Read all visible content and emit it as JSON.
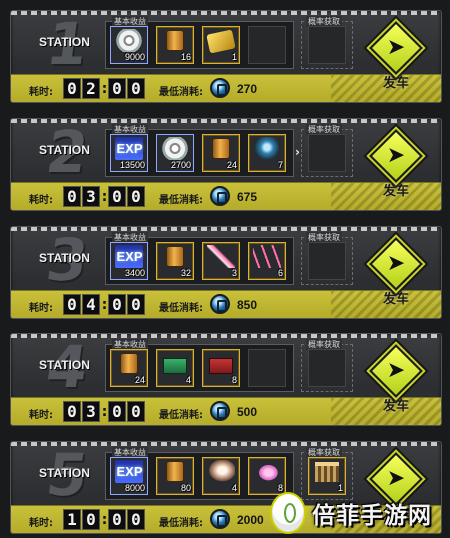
{
  "labels": {
    "station": "STATION",
    "base_reward": "基本收益",
    "prob_reward": "概率获取",
    "time": "耗时:",
    "min_cost": "最低消耗:",
    "depart": "发车"
  },
  "stations": [
    {
      "number": "1",
      "time": [
        "0",
        "2",
        "0",
        "0"
      ],
      "cost": "270",
      "items": [
        {
          "icon": "coin-icon",
          "qty": "9000",
          "style": "blue"
        },
        {
          "icon": "bottle-icon",
          "qty": "16",
          "style": "rare"
        },
        {
          "icon": "card-icon",
          "qty": "1",
          "style": "rare"
        }
      ],
      "prob_items": []
    },
    {
      "number": "2",
      "time": [
        "0",
        "3",
        "0",
        "0"
      ],
      "cost": "675",
      "items": [
        {
          "icon": "exp-icon",
          "qty": "13500",
          "style": "blue"
        },
        {
          "icon": "coin-icon",
          "qty": "2700",
          "style": "blue"
        },
        {
          "icon": "bottle-icon",
          "qty": "24",
          "style": "rare"
        },
        {
          "icon": "armor-icon",
          "qty": "7",
          "style": "rare"
        }
      ],
      "prob_items": []
    },
    {
      "number": "3",
      "time": [
        "0",
        "4",
        "0",
        "0"
      ],
      "cost": "850",
      "items": [
        {
          "icon": "exp-icon",
          "qty": "3400",
          "style": "blue"
        },
        {
          "icon": "bottle-icon",
          "qty": "32",
          "style": "rare"
        },
        {
          "icon": "feather-icon",
          "qty": "3",
          "style": "rare"
        },
        {
          "icon": "crystal-icon",
          "qty": "6",
          "style": "rare"
        }
      ],
      "prob_items": []
    },
    {
      "number": "4",
      "time": [
        "0",
        "3",
        "0",
        "0"
      ],
      "cost": "500",
      "items": [
        {
          "icon": "bottle-icon",
          "qty": "24",
          "style": "rare"
        },
        {
          "icon": "green-kit-icon",
          "qty": "4",
          "style": "rare"
        },
        {
          "icon": "red-kit-icon",
          "qty": "8",
          "style": "rare"
        }
      ],
      "prob_items": []
    },
    {
      "number": "5",
      "time": [
        "1",
        "0",
        "0",
        "0"
      ],
      "cost": "2000",
      "items": [
        {
          "icon": "exp-icon",
          "qty": "8000",
          "style": "blue"
        },
        {
          "icon": "bottle-icon",
          "qty": "80",
          "style": "rare"
        },
        {
          "icon": "wing-icon",
          "qty": "4",
          "style": "rare"
        },
        {
          "icon": "fish-icon",
          "qty": "8",
          "style": "rare"
        }
      ],
      "prob_items": [
        {
          "icon": "gate-icon",
          "qty": "1",
          "style": "rare"
        }
      ]
    }
  ],
  "exp_text": "EXP",
  "watermark": {
    "text": "倍菲手游网"
  },
  "colors": {
    "accent_yellow": "#c9c13a",
    "depart_green": "#d6ee2f",
    "panel": "#2f3134"
  }
}
